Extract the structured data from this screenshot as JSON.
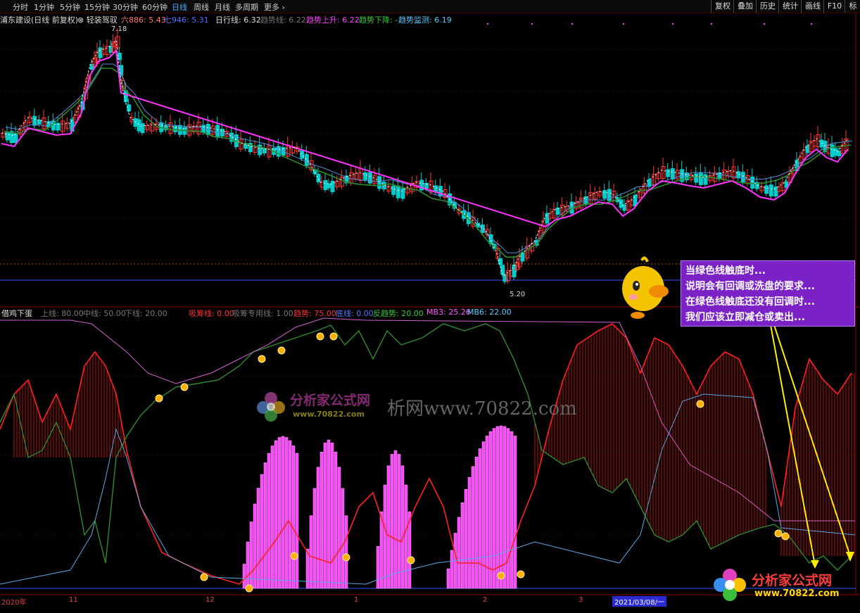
{
  "toolbar": {
    "periods": [
      "分时",
      "1分钟",
      "5分钟",
      "15分钟",
      "30分钟",
      "60分钟",
      "日线",
      "周线",
      "月线",
      "多周期",
      "更多 ›"
    ],
    "active": "日线",
    "right_buttons": [
      "复权",
      "叠加",
      "历史",
      "统计",
      "画线",
      "F10",
      "标"
    ]
  },
  "main_info": {
    "stock": "浦东建设(日线 前复权)",
    "indicator": "⊗ 轻装驾驭",
    "items": [
      {
        "label": "六886: 5.43",
        "color": "#ff7777"
      },
      {
        "label": "七946: 5.31",
        "color": "#4f6fff"
      },
      {
        "label": "日行线: 6.32",
        "color": "#dddddd"
      },
      {
        "label": "趋势线: 6.22",
        "color": "#777777"
      },
      {
        "label": "趋势上升: 6.22",
        "color": "#ff44ff"
      },
      {
        "label": "趋势下降: -",
        "color": "#33cc33"
      },
      {
        "label": "趋势监测: 6.19",
        "color": "#55ccff"
      }
    ],
    "high_label": "7.18",
    "low_label": "5.20"
  },
  "indicator_info": {
    "name": "借鸡下蛋",
    "items": [
      {
        "label": "上线: 80.00",
        "color": "#777777"
      },
      {
        "label": "中线: 50.00",
        "color": "#777777"
      },
      {
        "label": "下线: 20.00",
        "color": "#777777"
      },
      {
        "label": "吸筹线: 0.00",
        "color": "#ff3333"
      },
      {
        "label": "吸筹专用线: 1.00",
        "color": "#777777"
      },
      {
        "label": "趋势: 75.00",
        "color": "#ff3333"
      },
      {
        "label": "底线: 0.00",
        "color": "#5577ff"
      },
      {
        "label": "反趋势: 20.00",
        "color": "#33cc33"
      },
      {
        "label": "MB3: 25.26",
        "color": "#ff55ff"
      },
      {
        "label": "MB6: 22.00",
        "color": "#55ccff"
      }
    ]
  },
  "callout": {
    "lines": [
      "当绿色线触底时...",
      "说明会有回调或洗盘的要求...",
      "在绿色线触底还没有回调时...",
      "我们应该立即减仓或卖出..."
    ]
  },
  "watermark": {
    "brand": "分析家公式网",
    "url": "www.70822.com",
    "text_mid": "析网www.70822.com"
  },
  "axis": {
    "labels": [
      "2020年",
      "11",
      "12",
      "1",
      "2",
      "3",
      "2021/03/08/一"
    ]
  },
  "colors": {
    "up": "#ff3333",
    "down": "#00cccc",
    "green_line": "#2e8b2e",
    "magenta": "#ff33ff",
    "blue": "#5a8fd8"
  }
}
